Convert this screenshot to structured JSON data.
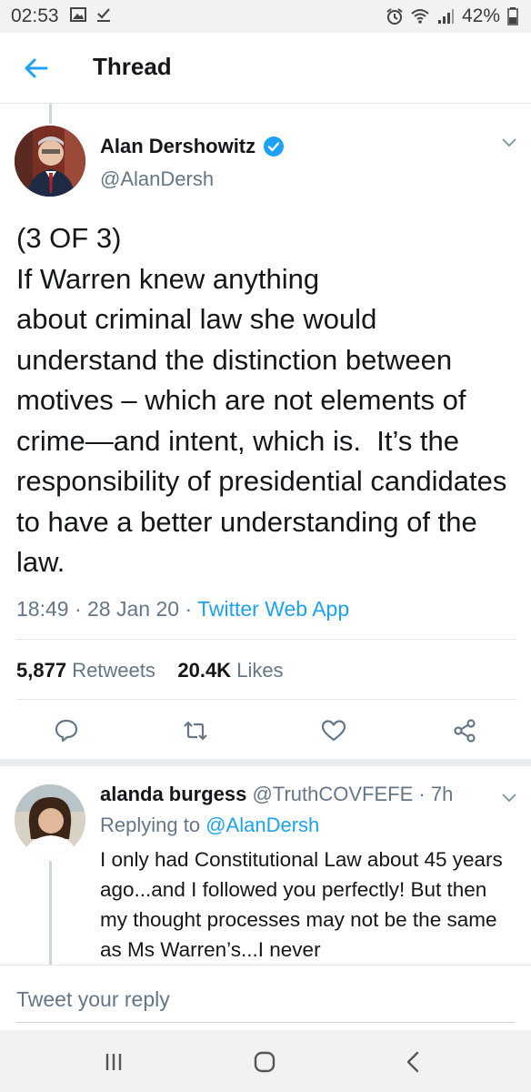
{
  "status_bar": {
    "time": "02:53",
    "battery": "42%",
    "left_icons": [
      "image-icon",
      "download-done-icon"
    ],
    "right_icons": [
      "alarm-icon",
      "wifi-icon",
      "signal-icon",
      "battery-icon"
    ]
  },
  "appbar": {
    "title": "Thread",
    "back_icon": "back-arrow-icon"
  },
  "tweet": {
    "display_name": "Alan Dershowitz",
    "handle": "@AlanDersh",
    "verified": true,
    "text": "(3 OF 3)\nIf Warren knew anything\nabout criminal law she would understand the distinction between motives – which are not elements of  crime—and intent, which is.  It’s the responsibility of presidential candidates to have a better understanding of the law.",
    "time": "18:49",
    "date": "28 Jan 20",
    "source": "Twitter Web App",
    "retweets_count": "5,877",
    "retweets_label": "Retweets",
    "likes_count": "20.4K",
    "likes_label": "Likes",
    "actions": [
      "reply-icon",
      "retweet-icon",
      "like-icon",
      "share-icon"
    ]
  },
  "reply": {
    "display_name": "alanda burgess",
    "handle": "@TruthCOVFEFE",
    "age": "7h",
    "replying_label": "Replying to",
    "replying_to": "@AlanDersh",
    "text": "I only had Constitutional Law about 45 years ago...and I followed you perfectly! But then  my thought processes may not be the same as Ms Warren’s...I never"
  },
  "compose": {
    "placeholder": "Tweet your reply"
  },
  "colors": {
    "accent": "#1da1f2",
    "muted": "#657786",
    "text": "#14171a",
    "divider": "#e1e8ed"
  },
  "navbar": {
    "buttons": [
      "recents-icon",
      "home-icon",
      "back-icon"
    ]
  }
}
